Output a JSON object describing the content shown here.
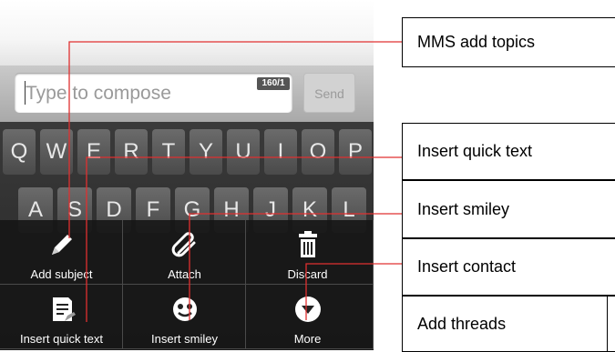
{
  "compose": {
    "placeholder": "Type to compose",
    "counter": "160/1",
    "send_label": "Send"
  },
  "keyboard": {
    "row1": [
      "Q",
      "W",
      "E",
      "R",
      "T",
      "Y",
      "U",
      "I",
      "O",
      "P"
    ],
    "row2": [
      "A",
      "S",
      "D",
      "F",
      "G",
      "H",
      "J",
      "K",
      "L"
    ]
  },
  "menu": {
    "items": [
      {
        "label": "Add subject",
        "icon": "pencil-icon"
      },
      {
        "label": "Attach",
        "icon": "paperclip-icon"
      },
      {
        "label": "Discard",
        "icon": "trash-icon"
      },
      {
        "label": "Insert quick text",
        "icon": "quick-text-icon"
      },
      {
        "label": "Insert smiley",
        "icon": "smiley-icon"
      },
      {
        "label": "More",
        "icon": "more-icon"
      }
    ]
  },
  "callouts": [
    "MMS add topics",
    "Insert quick text",
    "Insert smiley",
    "Insert contact",
    "Add threads"
  ],
  "colors": {
    "line": "#e03030",
    "menu_bg": "#161616"
  }
}
